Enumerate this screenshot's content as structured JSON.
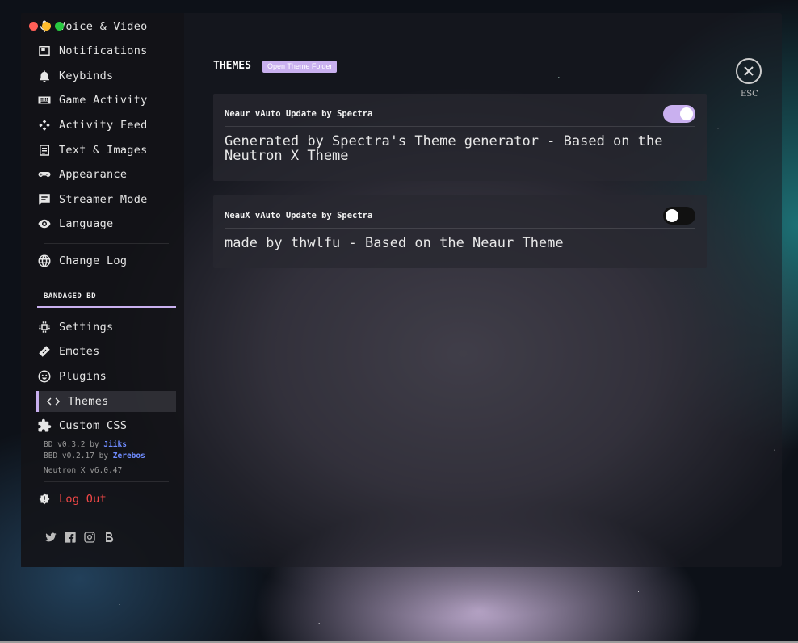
{
  "sidebar": {
    "items": [
      {
        "label": "Voice & Video",
        "icon": "mic-icon"
      },
      {
        "label": "Notifications",
        "icon": "bell-icon"
      },
      {
        "label": "Keybinds",
        "icon": "keyboard-icon"
      },
      {
        "label": "Game Activity",
        "icon": "gamepad-icon"
      },
      {
        "label": "Activity Feed",
        "icon": "activity-icon"
      },
      {
        "label": "Text & Images",
        "icon": "document-icon"
      },
      {
        "label": "Appearance",
        "icon": "eye-icon"
      },
      {
        "label": "Streamer Mode",
        "icon": "chat-icon"
      },
      {
        "label": "Language",
        "icon": "eye-icon"
      },
      {
        "label": "Change Log",
        "icon": "globe-icon"
      }
    ],
    "section_header": "BANDAGED BD",
    "bd_items": [
      {
        "label": "Settings",
        "icon": "chip-icon"
      },
      {
        "label": "Emotes",
        "icon": "bandage-icon"
      },
      {
        "label": "Plugins",
        "icon": "smiley-icon"
      },
      {
        "label": "Themes",
        "icon": "code-icon",
        "active": true
      },
      {
        "label": "Custom CSS",
        "icon": "puzzle-icon"
      }
    ],
    "versions": {
      "bd_prefix": "BD v0.3.2 by ",
      "bd_author": "Jiiks",
      "bbd_prefix": "BBD v0.2.17 by ",
      "bbd_author": "Zerebos",
      "theme": "Neutron X v6.0.47"
    },
    "logout": "Log Out",
    "socials": [
      "twitter-icon",
      "facebook-icon",
      "instagram-icon",
      "bd-icon"
    ]
  },
  "main": {
    "title": "THEMES",
    "open_folder": "Open Theme Folder",
    "themes": [
      {
        "name": "Neaur vAuto Update by Spectra",
        "description": "Generated by Spectra's Theme generator - Based on the Neutron X Theme",
        "enabled": true
      },
      {
        "name": "NeauX vAuto Update by Spectra",
        "description": "made by thwlfu - Based on the Neaur Theme",
        "enabled": false
      }
    ],
    "esc_label": "ESC"
  },
  "colors": {
    "accent": "#c9b0ef",
    "logout": "#f04747",
    "link": "#6f8cff"
  }
}
